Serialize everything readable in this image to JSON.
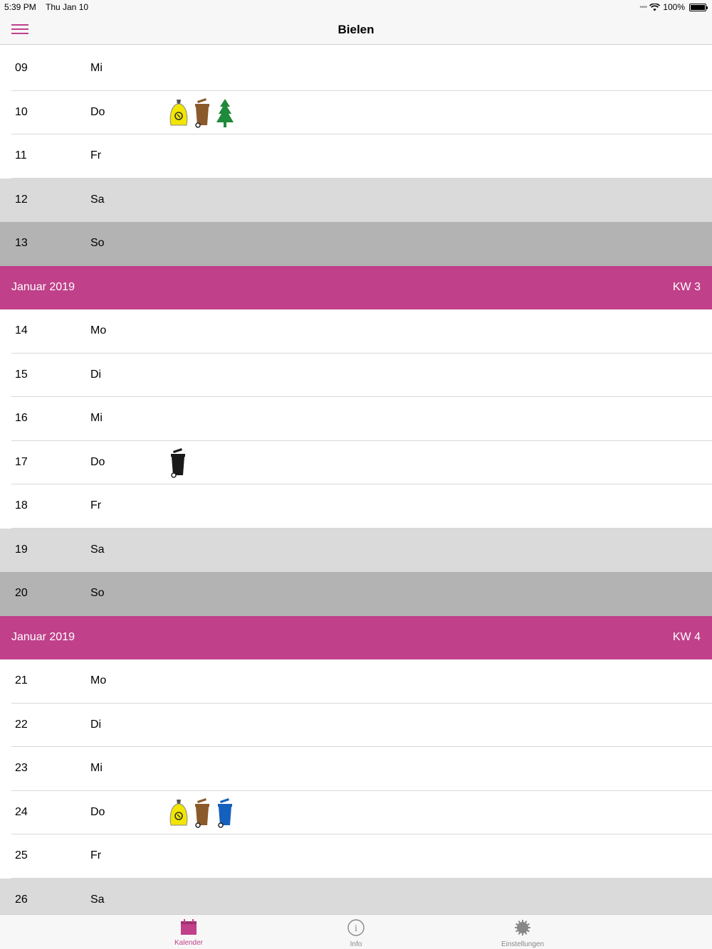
{
  "status": {
    "time": "5:39 PM",
    "date": "Thu Jan 10",
    "battery": "100%",
    "battery_level": 1.0
  },
  "nav": {
    "title": "Bielen",
    "menu_icon": "hamburger-menu-icon"
  },
  "colors": {
    "accent": "#c0408a",
    "saturday": "#dadada",
    "sunday": "#b3b3b3",
    "yellow_bag": "#f2e600",
    "bio_bin": "#8b5a2b",
    "paper_bin": "#1560bd",
    "residual_bin": "#1a1a1a",
    "tree": "#1e8a3a"
  },
  "rows": [
    {
      "type": "day",
      "day": "09",
      "weekday": "Mi",
      "kind": "",
      "icons": []
    },
    {
      "type": "day",
      "day": "10",
      "weekday": "Do",
      "kind": "",
      "icons": [
        "yellow-bag-icon",
        "bio-bin-icon",
        "christmas-tree-icon"
      ]
    },
    {
      "type": "day",
      "day": "11",
      "weekday": "Fr",
      "kind": "",
      "icons": []
    },
    {
      "type": "day",
      "day": "12",
      "weekday": "Sa",
      "kind": "sat",
      "icons": []
    },
    {
      "type": "day",
      "day": "13",
      "weekday": "So",
      "kind": "sun",
      "icons": []
    },
    {
      "type": "header",
      "month": "Januar 2019",
      "week": "KW 3"
    },
    {
      "type": "day",
      "day": "14",
      "weekday": "Mo",
      "kind": "",
      "icons": []
    },
    {
      "type": "day",
      "day": "15",
      "weekday": "Di",
      "kind": "",
      "icons": []
    },
    {
      "type": "day",
      "day": "16",
      "weekday": "Mi",
      "kind": "",
      "icons": []
    },
    {
      "type": "day",
      "day": "17",
      "weekday": "Do",
      "kind": "",
      "icons": [
        "residual-bin-icon"
      ]
    },
    {
      "type": "day",
      "day": "18",
      "weekday": "Fr",
      "kind": "",
      "icons": []
    },
    {
      "type": "day",
      "day": "19",
      "weekday": "Sa",
      "kind": "sat",
      "icons": []
    },
    {
      "type": "day",
      "day": "20",
      "weekday": "So",
      "kind": "sun",
      "icons": []
    },
    {
      "type": "header",
      "month": "Januar 2019",
      "week": "KW 4"
    },
    {
      "type": "day",
      "day": "21",
      "weekday": "Mo",
      "kind": "",
      "icons": []
    },
    {
      "type": "day",
      "day": "22",
      "weekday": "Di",
      "kind": "",
      "icons": []
    },
    {
      "type": "day",
      "day": "23",
      "weekday": "Mi",
      "kind": "",
      "icons": []
    },
    {
      "type": "day",
      "day": "24",
      "weekday": "Do",
      "kind": "",
      "icons": [
        "yellow-bag-icon",
        "bio-bin-icon",
        "paper-bin-icon"
      ]
    },
    {
      "type": "day",
      "day": "25",
      "weekday": "Fr",
      "kind": "",
      "icons": []
    },
    {
      "type": "day",
      "day": "26",
      "weekday": "Sa",
      "kind": "sat",
      "icons": []
    }
  ],
  "tabs": [
    {
      "label": "Kalender",
      "icon": "calendar-icon",
      "active": true
    },
    {
      "label": "Info",
      "icon": "info-icon",
      "active": false
    },
    {
      "label": "Einstellungen",
      "icon": "settings-gear-icon",
      "active": false
    }
  ]
}
